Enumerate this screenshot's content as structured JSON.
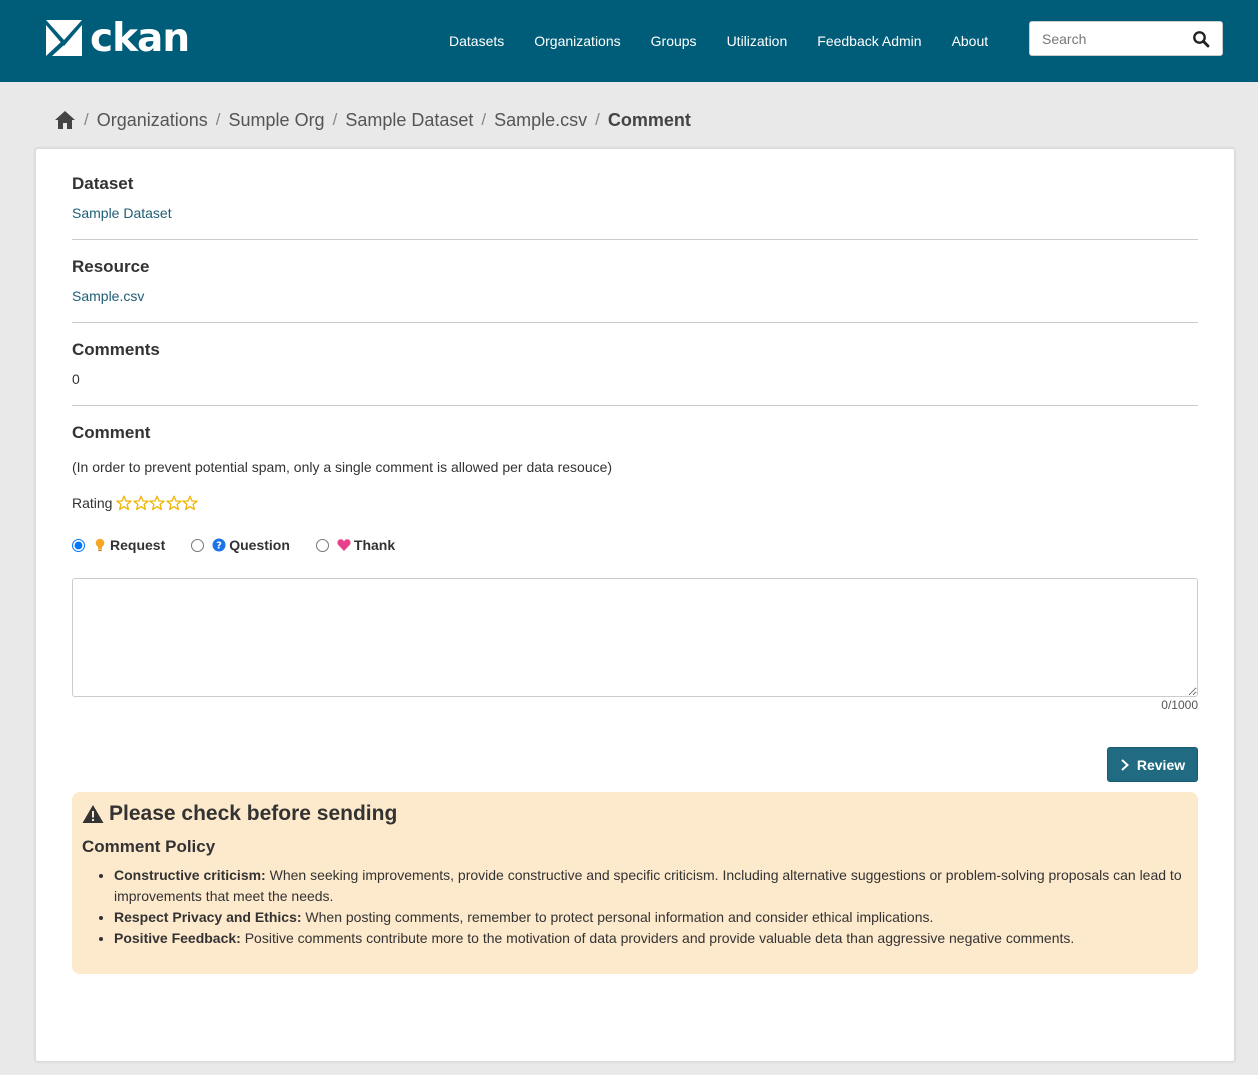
{
  "header": {
    "logo_text": "ckan",
    "nav": [
      "Datasets",
      "Organizations",
      "Groups",
      "Utilization",
      "Feedback Admin",
      "About"
    ],
    "search_placeholder": "Search"
  },
  "breadcrumb": {
    "items": [
      "Organizations",
      "Sumple Org",
      "Sample Dataset",
      "Sample.csv"
    ],
    "active": "Comment"
  },
  "dataset": {
    "heading": "Dataset",
    "value": "Sample Dataset"
  },
  "resource": {
    "heading": "Resource",
    "value": "Sample.csv"
  },
  "comments": {
    "heading": "Comments",
    "value": "0"
  },
  "comment_form": {
    "heading": "Comment",
    "note": "(In order to prevent potential spam, only a single comment is allowed per data resouce)",
    "rating_label": "Rating",
    "rating_value": 0,
    "rating_max": 5,
    "categories": [
      "Request",
      "Question",
      "Thank"
    ],
    "selected_category": "Request",
    "textarea_value": "",
    "counter": "0/1000",
    "review_label": "Review"
  },
  "policy": {
    "title": "Please check before sending",
    "subtitle": "Comment Policy",
    "items": [
      {
        "term": "Constructive criticism:",
        "text": " When seeking improvements, provide constructive and specific criticism. Including alternative suggestions or problem-solving proposals can lead to improvements that meet the needs."
      },
      {
        "term": "Respect Privacy and Ethics:",
        "text": " When posting comments, remember to protect personal information and consider ethical implications."
      },
      {
        "term": "Positive Feedback:",
        "text": " Positive comments contribute more to the motivation of data providers and provide valuable deta than aggressive negative comments."
      }
    ]
  },
  "colors": {
    "header_bg": "#005d7a",
    "link": "#1f5e76",
    "button": "#206b82",
    "warning_bg": "#fde9cc",
    "star": "#f0b400",
    "request_icon": "#f5a623",
    "question_icon": "#1a73e8",
    "thank_icon": "#e8408a"
  },
  "icons": {
    "logo": "ckan-logo-icon",
    "search": "search-icon",
    "home": "home-icon",
    "star": "star-outline-icon",
    "request": "lightbulb-icon",
    "question": "question-circle-icon",
    "thank": "heart-icon",
    "review": "chevron-right-icon",
    "warning": "warning-triangle-icon"
  }
}
